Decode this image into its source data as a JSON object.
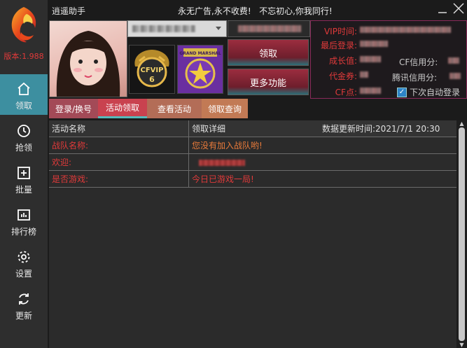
{
  "app": {
    "title": "逍遥助手",
    "slogan": "永无广告,永不收费!   不忘初心,你我同行!",
    "version_label": "版本:1.988"
  },
  "sidebar": {
    "items": [
      {
        "label": "领取",
        "icon": "home-icon",
        "active": true
      },
      {
        "label": "抢领",
        "icon": "clock-icon",
        "active": false
      },
      {
        "label": "批量",
        "icon": "plus-box-icon",
        "active": false
      },
      {
        "label": "排行榜",
        "icon": "chart-icon",
        "active": false
      },
      {
        "label": "设置",
        "icon": "gear-icon",
        "active": false
      },
      {
        "label": "更新",
        "icon": "refresh-icon",
        "active": false
      }
    ]
  },
  "account": {
    "badge1_text": "CFVIP",
    "badge1_level": "6",
    "badge2_text": "GRAND MARSHAL"
  },
  "buttons": {
    "claim": "领取",
    "more": "更多功能"
  },
  "info": {
    "vip_time": "VIP时间:",
    "last_login": "最后登录:",
    "growth": "成长值:",
    "cf_credit": "CF信用分:",
    "voucher": "代金券:",
    "tencent_credit": "腾讯信用分:",
    "cf_points": "CF点:",
    "auto_login": "下次自动登录"
  },
  "tabs": [
    "登录/换号",
    "活动领取",
    "查看活动",
    "领取查询"
  ],
  "table": {
    "headers": [
      "活动名称",
      "领取详细"
    ],
    "update_label": "数据更新时间:2021/7/1 20:30",
    "rows": [
      {
        "name": "战队名称:",
        "detail": "您没有加入战队哟!"
      },
      {
        "name": "欢迎:",
        "detail": ""
      },
      {
        "name": "是否游戏:",
        "detail": "今日已游戏一局!"
      }
    ]
  },
  "colors": {
    "accent_teal": "#3d8fa0",
    "label_red": "#e03a3a",
    "tab_active": "#c9424f"
  }
}
